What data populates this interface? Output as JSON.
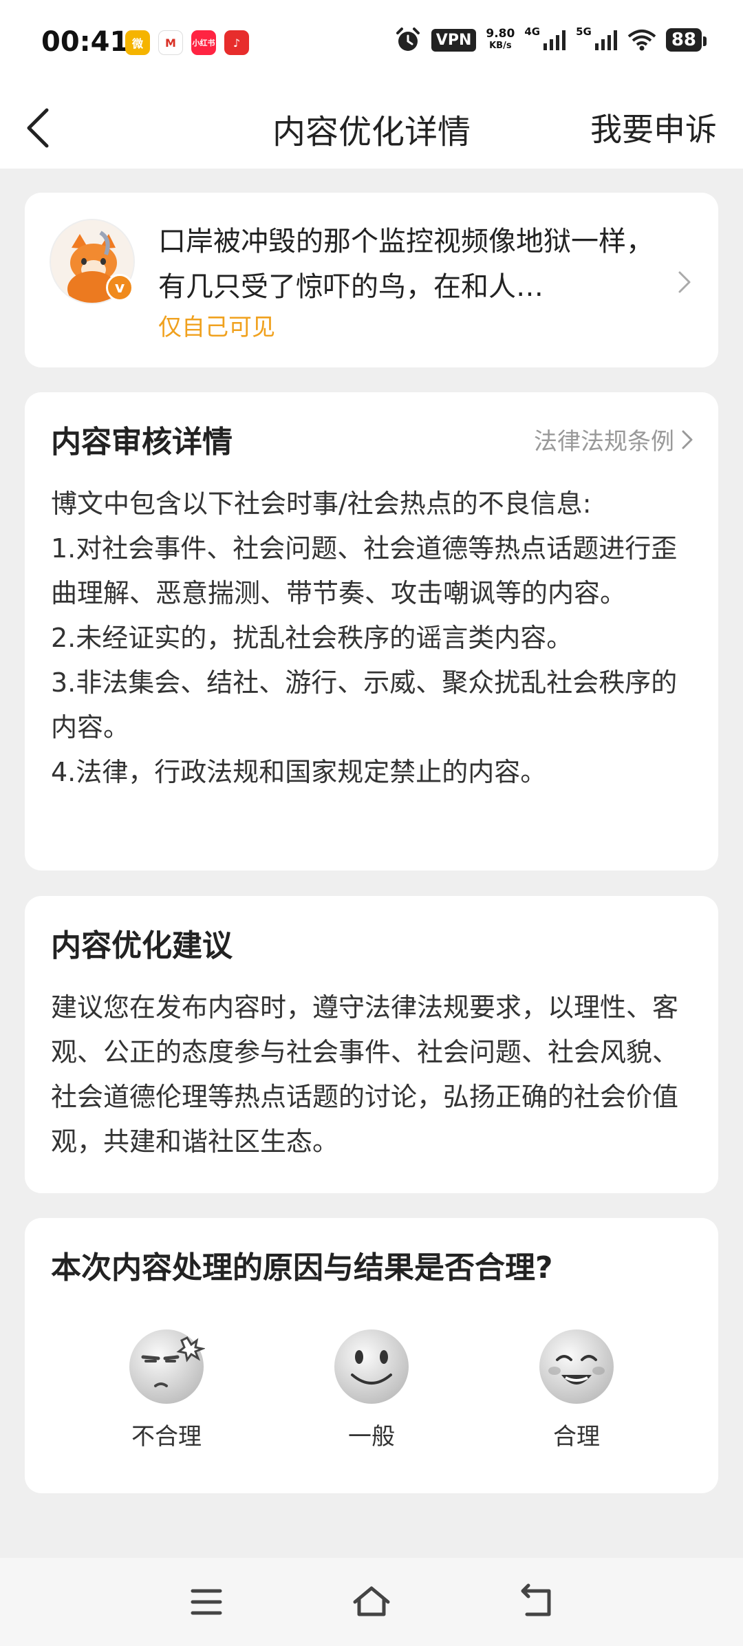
{
  "status_bar": {
    "time": "00:41",
    "app_icons": [
      {
        "name": "weibo-app-icon",
        "glyph": "微",
        "color": "#f5b400"
      },
      {
        "name": "gmail-app-icon",
        "glyph": "M",
        "color": "#ffffff"
      },
      {
        "name": "xiaohongshu-app-icon",
        "glyph": "小红书",
        "color": "#ff2442"
      },
      {
        "name": "netease-music-app-icon",
        "glyph": "♪",
        "color": "#e72d2c"
      }
    ],
    "vpn": "VPN",
    "net_speed_value": "9.80",
    "net_speed_unit": "KB/s",
    "signal_1": "4G",
    "signal_2": "5G",
    "battery": "88"
  },
  "navbar": {
    "title": "内容优化详情",
    "appeal": "我要申诉"
  },
  "post": {
    "text": "口岸被冲毁的那个监控视频像地狱一样，有几只受了惊吓的鸟，在和人…",
    "visibility": "仅自己可见"
  },
  "review": {
    "title": "内容审核详情",
    "law_link": "法律法规条例",
    "lines": [
      "博文中包含以下社会时事/社会热点的不良信息:",
      "1.对社会事件、社会问题、社会道德等热点话题进行歪曲理解、恶意揣测、带节奏、攻击嘲讽等的内容。",
      "2.未经证实的，扰乱社会秩序的谣言类内容。",
      "3.非法集会、结社、游行、示威、聚众扰乱社会秩序的内容。",
      "4.法律，行政法规和国家规定禁止的内容。"
    ]
  },
  "suggestion": {
    "title": "内容优化建议",
    "text": "建议您在发布内容时，遵守法律法规要求，以理性、客观、公正的态度参与社会事件、社会问题、社会风貌、社会道德伦理等热点话题的讨论，弘扬正确的社会价值观，共建和谐社区生态。"
  },
  "feedback": {
    "question": "本次内容处理的原因与结果是否合理?",
    "options": [
      "不合理",
      "一般",
      "合理"
    ]
  }
}
